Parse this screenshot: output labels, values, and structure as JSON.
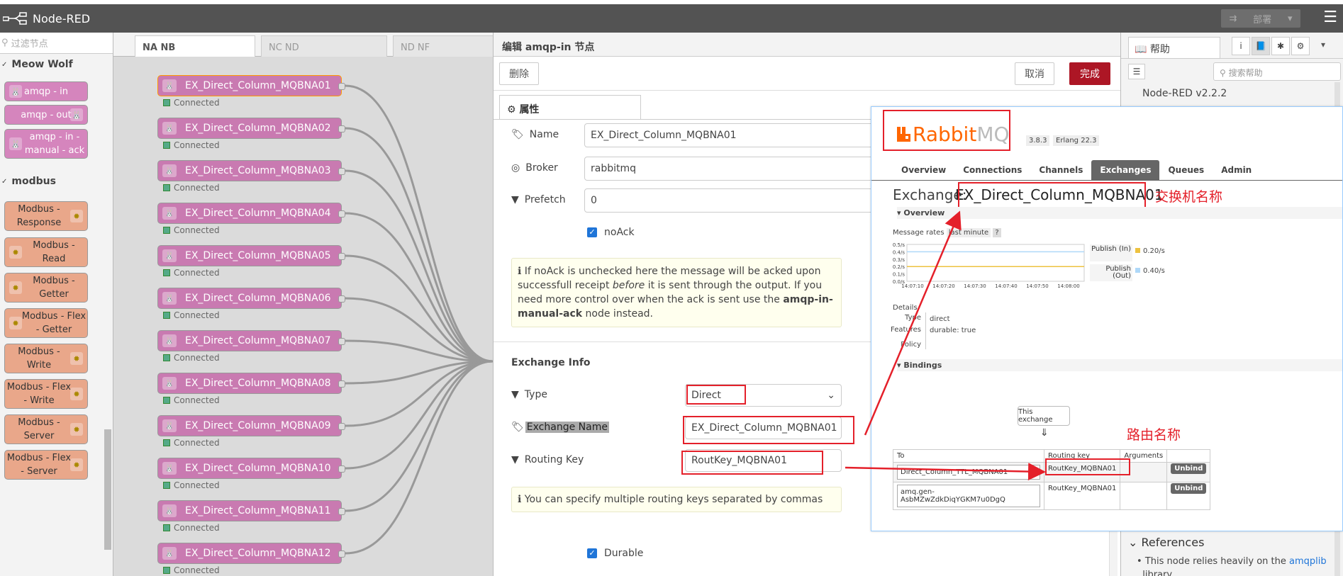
{
  "app": {
    "title": "Node-RED",
    "deploy_label": "部署"
  },
  "palette": {
    "filter_placeholder": "过滤节点",
    "categories": [
      "Meow Wolf",
      "modbus"
    ],
    "meow_nodes": [
      "amqp - in",
      "amqp - out",
      "amqp - in - manual - ack"
    ],
    "modbus_nodes": [
      "Modbus - Response",
      "Modbus - Read",
      "Modbus - Getter",
      "Modbus - Flex - Getter",
      "Modbus - Write",
      "Modbus - Flex - Write",
      "Modbus - Server",
      "Modbus - Flex - Server"
    ]
  },
  "workspace": {
    "tabs": [
      "NA NB",
      "NC ND",
      "ND NF"
    ],
    "status_text": "Connected",
    "nodes": [
      "EX_Direct_Column_MQBNA01",
      "EX_Direct_Column_MQBNA02",
      "EX_Direct_Column_MQBNA03",
      "EX_Direct_Column_MQBNA04",
      "EX_Direct_Column_MQBNA05",
      "EX_Direct_Column_MQBNA06",
      "EX_Direct_Column_MQBNA07",
      "EX_Direct_Column_MQBNA08",
      "EX_Direct_Column_MQBNA09",
      "EX_Direct_Column_MQBNA10",
      "EX_Direct_Column_MQBNA11",
      "EX_Direct_Column_MQBNA12"
    ]
  },
  "editor": {
    "title": "编辑 amqp-in 节点",
    "delete_label": "删除",
    "cancel_label": "取消",
    "done_label": "完成",
    "tab_label": "属性",
    "name_label": "Name",
    "name_value": "EX_Direct_Column_MQBNA01",
    "broker_label": "Broker",
    "broker_value": "rabbitmq",
    "prefetch_label": "Prefetch",
    "prefetch_value": "0",
    "noack_label": "noAck",
    "info_pre": "If noAck is unchecked here the message will be acked upon successfull receipt ",
    "info_em": "before",
    "info_mid": " it is sent through the output. If you need more control over when the ack is sent use the ",
    "info_strong": "amqp-in-manual-ack",
    "info_post": " node instead.",
    "exchange_info_label": "Exchange Info",
    "type_label": "Type",
    "type_value": "Direct",
    "exchange_name_label": "Exchange Name",
    "exchange_name_value": "EX_Direct_Column_MQBNA01",
    "routing_key_label": "Routing Key",
    "routing_key_value": "RoutKey_MQBNA01",
    "routing_hint": "You can specify multiple routing keys separated by commas",
    "durable_label": "Durable"
  },
  "help": {
    "tab_label": "帮助",
    "search_placeholder": "搜索帮助",
    "version": "Node-RED v2.2.2",
    "references_label": "References",
    "ref_text": "This node relies heavily on the ",
    "ref_link": "amqplib",
    "ref_tail": "library"
  },
  "rabbit": {
    "logo_a": "Rabbit",
    "logo_b": "MQ",
    "version": "3.8.3",
    "erlang": "Erlang 22.3",
    "tabs": [
      "Overview",
      "Connections",
      "Channels",
      "Exchanges",
      "Queues",
      "Admin"
    ],
    "active_tab": "Exchanges",
    "exchange_prefix": "Exchange:",
    "exchange_name": "EX_Direct_Column_MQBNA01",
    "overview_label": "Overview",
    "message_rates": "Message rates",
    "last_minute": "last minute",
    "y_ticks": [
      "0.5/s",
      "0.4/s",
      "0.3/s",
      "0.2/s",
      "0.1/s",
      "0.0/s"
    ],
    "x_ticks": [
      "14:07:10",
      "14:07:20",
      "14:07:30",
      "14:07:40",
      "14:07:50",
      "14:08:00"
    ],
    "publish_in_label": "Publish (In)",
    "publish_in_value": "0.20/s",
    "publish_out_label": "Publish (Out)",
    "publish_out_value": "0.40/s",
    "details_label": "Details",
    "type_label": "Type",
    "type_value": "direct",
    "features_label": "Features",
    "features_value": "durable:",
    "features_bool": "true",
    "policy_label": "Policy",
    "bindings_label": "Bindings",
    "this_exchange": "This exchange",
    "arrow_down": "⇓",
    "col_to": "To",
    "col_routing": "Routing key",
    "col_args": "Arguments",
    "rows": [
      {
        "to": "Direct_Column_TTL_MQBNA01",
        "key": "RoutKey_MQBNA01"
      },
      {
        "to": "amq.gen-AsbMZwZdkDiqYGKM7u0DgQ",
        "key": "RoutKey_MQBNA01"
      }
    ],
    "unbind_label": "Unbind",
    "annot_exchange": "交换机名称",
    "annot_route": "路由名称"
  },
  "colors": {
    "accent_red": "#e4202a",
    "node_pink": "#c97ab1",
    "rabbit_orange": "#f60"
  }
}
